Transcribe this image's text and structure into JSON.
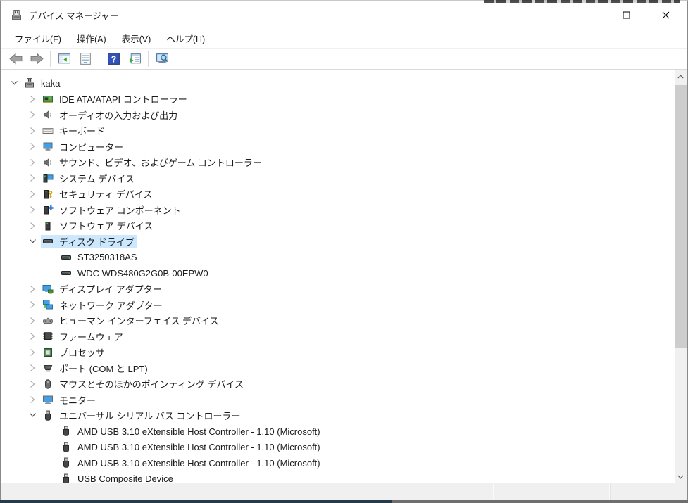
{
  "window": {
    "title": "デバイス マネージャー",
    "app_icon": "device-manager-icon",
    "controls": [
      {
        "name": "minimize-button",
        "icon": "minimize-icon"
      },
      {
        "name": "maximize-button",
        "icon": "maximize-icon"
      },
      {
        "name": "close-button",
        "icon": "close-icon"
      }
    ]
  },
  "menu": {
    "items": [
      "ファイル(F)",
      "操作(A)",
      "表示(V)",
      "ヘルプ(H)"
    ]
  },
  "toolbar": {
    "buttons": [
      {
        "type": "button",
        "icon": "back-icon",
        "name": "back-button"
      },
      {
        "type": "button",
        "icon": "forward-icon",
        "name": "forward-button"
      },
      {
        "type": "separator"
      },
      {
        "type": "button",
        "icon": "console-tree-icon",
        "name": "show-console-tree-button"
      },
      {
        "type": "button",
        "icon": "properties-icon",
        "name": "properties-button"
      },
      {
        "type": "gap"
      },
      {
        "type": "button",
        "icon": "help-icon",
        "name": "help-button"
      },
      {
        "type": "button",
        "icon": "export-list-icon",
        "name": "export-list-button"
      },
      {
        "type": "separator"
      },
      {
        "type": "button",
        "icon": "scan-icon",
        "name": "scan-hardware-changes-button"
      }
    ]
  },
  "tree": {
    "items": [
      {
        "label": "kaka",
        "level": 0,
        "icon": "computer-root-icon",
        "state": "expanded",
        "selected": false
      },
      {
        "label": "IDE ATA/ATAPI コントローラー",
        "level": 1,
        "icon": "ide-controller-icon",
        "state": "collapsed",
        "selected": false
      },
      {
        "label": "オーディオの入力および出力",
        "level": 1,
        "icon": "audio-io-icon",
        "state": "collapsed",
        "selected": false
      },
      {
        "label": "キーボード",
        "level": 1,
        "icon": "keyboard-icon",
        "state": "collapsed",
        "selected": false
      },
      {
        "label": "コンピューター",
        "level": 1,
        "icon": "computer-icon",
        "state": "collapsed",
        "selected": false
      },
      {
        "label": "サウンド、ビデオ、およびゲーム コントローラー",
        "level": 1,
        "icon": "sound-icon",
        "state": "collapsed",
        "selected": false
      },
      {
        "label": "システム デバイス",
        "level": 1,
        "icon": "system-devices-icon",
        "state": "collapsed",
        "selected": false
      },
      {
        "label": "セキュリティ デバイス",
        "level": 1,
        "icon": "security-devices-icon",
        "state": "collapsed",
        "selected": false
      },
      {
        "label": "ソフトウェア コンポーネント",
        "level": 1,
        "icon": "software-components-icon",
        "state": "collapsed",
        "selected": false
      },
      {
        "label": "ソフトウェア デバイス",
        "level": 1,
        "icon": "software-devices-icon",
        "state": "collapsed",
        "selected": false
      },
      {
        "label": "ディスク ドライブ",
        "level": 1,
        "icon": "disk-drive-icon",
        "state": "expanded",
        "selected": true
      },
      {
        "label": "ST3250318AS",
        "level": 2,
        "icon": "disk-drive-icon",
        "state": "none",
        "selected": false
      },
      {
        "label": "WDC WDS480G2G0B-00EPW0",
        "level": 2,
        "icon": "disk-drive-icon",
        "state": "none",
        "selected": false
      },
      {
        "label": "ディスプレイ アダプター",
        "level": 1,
        "icon": "display-adapters-icon",
        "state": "collapsed",
        "selected": false
      },
      {
        "label": "ネットワーク アダプター",
        "level": 1,
        "icon": "network-adapters-icon",
        "state": "collapsed",
        "selected": false
      },
      {
        "label": "ヒューマン インターフェイス デバイス",
        "level": 1,
        "icon": "hid-icon",
        "state": "collapsed",
        "selected": false
      },
      {
        "label": "ファームウェア",
        "level": 1,
        "icon": "firmware-icon",
        "state": "collapsed",
        "selected": false
      },
      {
        "label": "プロセッサ",
        "level": 1,
        "icon": "processor-icon",
        "state": "collapsed",
        "selected": false
      },
      {
        "label": "ポート (COM と LPT)",
        "level": 1,
        "icon": "ports-icon",
        "state": "collapsed",
        "selected": false
      },
      {
        "label": "マウスとそのほかのポインティング デバイス",
        "level": 1,
        "icon": "mouse-icon",
        "state": "collapsed",
        "selected": false
      },
      {
        "label": "モニター",
        "level": 1,
        "icon": "monitor-icon",
        "state": "collapsed",
        "selected": false
      },
      {
        "label": "ユニバーサル シリアル バス コントローラー",
        "level": 1,
        "icon": "usb-icon",
        "state": "expanded",
        "selected": false
      },
      {
        "label": "AMD USB 3.10 eXtensible Host Controller - 1.10 (Microsoft)",
        "level": 2,
        "icon": "usb-icon",
        "state": "none",
        "selected": false
      },
      {
        "label": "AMD USB 3.10 eXtensible Host Controller - 1.10 (Microsoft)",
        "level": 2,
        "icon": "usb-icon",
        "state": "none",
        "selected": false
      },
      {
        "label": "AMD USB 3.10 eXtensible Host Controller - 1.10 (Microsoft)",
        "level": 2,
        "icon": "usb-icon",
        "state": "none",
        "selected": false
      },
      {
        "label": "USB Composite Device",
        "level": 2,
        "icon": "usb-icon",
        "state": "none",
        "selected": false
      }
    ]
  },
  "status_bar": {
    "panes": [
      "",
      "",
      ""
    ]
  },
  "colors": {
    "selection_highlight": "#cce8ff",
    "window_background": "#ffffff",
    "toolbar_border": "#d9d9d9",
    "statusbar_background": "#f0f0f0",
    "scrollbar_track": "#f0f0f0",
    "scrollbar_thumb": "#cdcdcd",
    "text": "#1b1b1b"
  }
}
